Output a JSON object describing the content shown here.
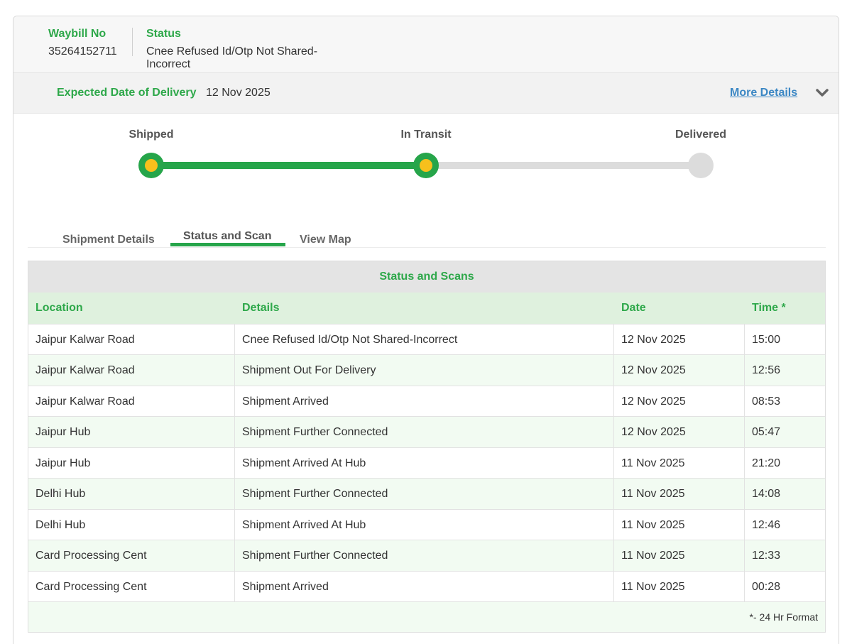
{
  "header": {
    "waybill_label": "Waybill No",
    "waybill_value": "35264152711",
    "status_label": "Status",
    "status_line1": "Cnee Refused Id/Otp Not Shared-",
    "status_line2": "Incorrect"
  },
  "delivery": {
    "label": "Expected Date of Delivery",
    "value": "12 Nov 2025",
    "more_details": "More Details",
    "chevron_icon": "chevron-down-icon"
  },
  "progress": {
    "steps": [
      {
        "label": "Shipped",
        "state": "done"
      },
      {
        "label": "In Transit",
        "state": "done"
      },
      {
        "label": "Delivered",
        "state": "pending"
      }
    ],
    "colors": {
      "done": "#26a54a",
      "current_dot": "#f7c01c",
      "pending": "#dcdcdc"
    }
  },
  "tabs": [
    {
      "label": "Shipment Details",
      "active": false
    },
    {
      "label": "Status and Scan",
      "active": true
    },
    {
      "label": "View Map",
      "active": false
    }
  ],
  "scans": {
    "title": "Status and Scans",
    "columns": [
      "Location",
      "Details",
      "Date",
      "Time *"
    ],
    "rows": [
      [
        "Jaipur Kalwar Road",
        "Cnee Refused Id/Otp Not Shared-Incorrect",
        "12 Nov 2025",
        "15:00"
      ],
      [
        "Jaipur Kalwar Road",
        "Shipment Out For Delivery",
        "12 Nov 2025",
        "12:56"
      ],
      [
        "Jaipur Kalwar Road",
        "Shipment Arrived",
        "12 Nov 2025",
        "08:53"
      ],
      [
        "Jaipur Hub",
        "Shipment Further Connected",
        "12 Nov 2025",
        "05:47"
      ],
      [
        "Jaipur Hub",
        "Shipment Arrived At Hub",
        "11 Nov 2025",
        "21:20"
      ],
      [
        "Delhi Hub",
        "Shipment Further Connected",
        "11 Nov 2025",
        "14:08"
      ],
      [
        "Delhi Hub",
        "Shipment Arrived At Hub",
        "11 Nov 2025",
        "12:46"
      ],
      [
        "Card Processing Cent",
        "Shipment Further Connected",
        "11 Nov 2025",
        "12:33"
      ],
      [
        "Card Processing Cent",
        "Shipment Arrived",
        "11 Nov 2025",
        "00:28"
      ]
    ],
    "footnote": "*- 24 Hr Format"
  },
  "colors": {
    "accent_green": "#2ea84a",
    "link_blue": "#3b87c4"
  }
}
